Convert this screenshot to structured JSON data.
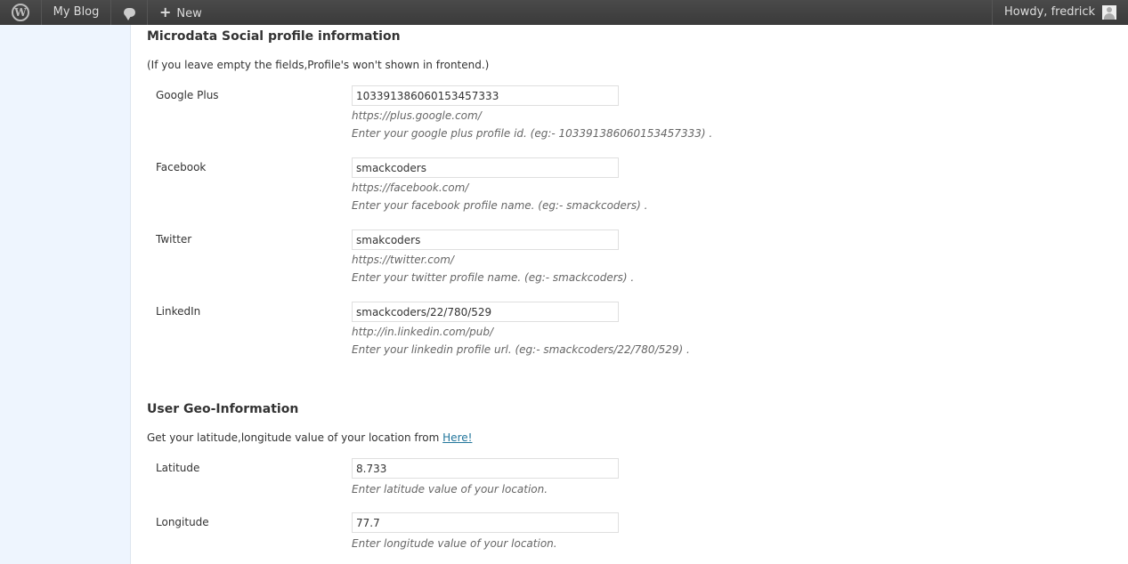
{
  "adminbar": {
    "wp_logo": "W",
    "site_name": "My Blog",
    "comments_icon": "comment-bubble-icon",
    "new_label": "New",
    "new_icon": "+",
    "account_label": "Howdy, fredrick"
  },
  "microdata": {
    "title": "Microdata Social profile information",
    "note": "(If you leave empty the fields,Profile's won't shown in frontend.)",
    "fields": [
      {
        "label": "Google Plus",
        "value": "103391386060153457333",
        "prefix": "https://plus.google.com/",
        "help": "Enter your google plus profile id. (eg:- 103391386060153457333) ."
      },
      {
        "label": "Facebook",
        "value": "smackcoders",
        "prefix": "https://facebook.com/",
        "help": "Enter your facebook profile name. (eg:- smackcoders) ."
      },
      {
        "label": "Twitter",
        "value": "smakcoders",
        "prefix": "https://twitter.com/",
        "help": "Enter your twitter profile name. (eg:- smackcoders) ."
      },
      {
        "label": "LinkedIn",
        "value": "smackcoders/22/780/529",
        "prefix": "http://in.linkedin.com/pub/",
        "help": "Enter your linkedin profile url. (eg:- smackcoders/22/780/529) ."
      }
    ]
  },
  "geo": {
    "title": "User Geo-Information",
    "note_text": "Get your latitude,longitude value of your location from ",
    "note_link": "Here!",
    "fields": [
      {
        "label": "Latitude",
        "value": "8.733",
        "help": "Enter latitude value of your location."
      },
      {
        "label": "Longitude",
        "value": "77.7",
        "help": "Enter longitude value of your location."
      }
    ]
  }
}
